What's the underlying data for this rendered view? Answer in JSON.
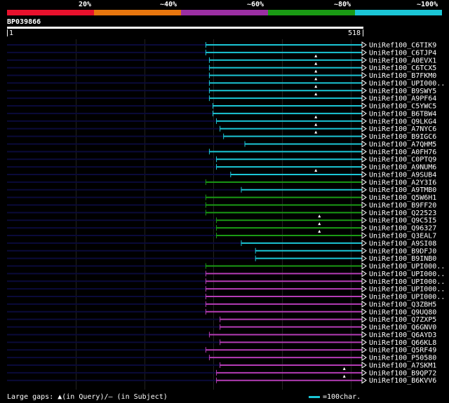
{
  "legend": {
    "labels": [
      "20%",
      "~40%",
      "~60%",
      "~80%",
      "~100%"
    ],
    "colors": [
      "#e8112d",
      "#e7760e",
      "#9b2fa3",
      "#1a9a14",
      "#1bc6d6"
    ]
  },
  "query": {
    "title": "BP039866",
    "start": "1",
    "end": "518"
  },
  "colors": {
    "cyan": "#1bc6d6",
    "green": "#1a9a14",
    "magenta": "#b53cb6",
    "faint": "#0a0a3a"
  },
  "hits": [
    {
      "label": "UniRef100_C6TIK9",
      "color": "cyan",
      "start": 0.56,
      "mark": null
    },
    {
      "label": "UniRef100_C6TJP4",
      "color": "cyan",
      "start": 0.56,
      "mark": null
    },
    {
      "label": "UniRef100_A0EVX1",
      "color": "cyan",
      "start": 0.57,
      "mark": 0.87
    },
    {
      "label": "UniRef100_C6TCX5",
      "color": "cyan",
      "start": 0.57,
      "mark": 0.87
    },
    {
      "label": "UniRef100_B7FKM0",
      "color": "cyan",
      "start": 0.57,
      "mark": 0.87
    },
    {
      "label": "UniRef100_UPI000..",
      "color": "cyan",
      "start": 0.57,
      "mark": 0.87
    },
    {
      "label": "UniRef100_B9SWY5",
      "color": "cyan",
      "start": 0.57,
      "mark": 0.87
    },
    {
      "label": "UniRef100_A9PF64",
      "color": "cyan",
      "start": 0.57,
      "mark": 0.87
    },
    {
      "label": "UniRef100_C5YWC5",
      "color": "cyan",
      "start": 0.58,
      "mark": null
    },
    {
      "label": "UniRef100_B6TBW4",
      "color": "cyan",
      "start": 0.58,
      "mark": null
    },
    {
      "label": "UniRef100_Q9LKG4",
      "color": "cyan",
      "start": 0.59,
      "mark": 0.87
    },
    {
      "label": "UniRef100_A7NYC6",
      "color": "cyan",
      "start": 0.6,
      "mark": 0.87
    },
    {
      "label": "UniRef100_B9IGC6",
      "color": "cyan",
      "start": 0.61,
      "mark": 0.87
    },
    {
      "label": "UniRef100_A7QHM5",
      "color": "cyan",
      "start": 0.67,
      "mark": null
    },
    {
      "label": "UniRef100_A0FH76",
      "color": "cyan",
      "start": 0.57,
      "mark": null
    },
    {
      "label": "UniRef100_C0PTQ9",
      "color": "cyan",
      "start": 0.59,
      "mark": null
    },
    {
      "label": "UniRef100_A9NUM6",
      "color": "cyan",
      "start": 0.59,
      "mark": null
    },
    {
      "label": "UniRef100_A9SUB4",
      "color": "cyan",
      "start": 0.63,
      "mark": 0.87
    },
    {
      "label": "UniRef100_A2Y3I6",
      "color": "green",
      "start": 0.56,
      "mark": null
    },
    {
      "label": "UniRef100_A9TMB0",
      "color": "cyan",
      "start": 0.66,
      "mark": null
    },
    {
      "label": "UniRef100_Q5W6H1",
      "color": "green",
      "start": 0.56,
      "mark": null
    },
    {
      "label": "UniRef100_B9FF20",
      "color": "green",
      "start": 0.56,
      "mark": null
    },
    {
      "label": "UniRef100_Q22523",
      "color": "green",
      "start": 0.56,
      "mark": null
    },
    {
      "label": "UniRef100_Q9C5I5",
      "color": "green",
      "start": 0.59,
      "mark": 0.88
    },
    {
      "label": "UniRef100_Q96327",
      "color": "green",
      "start": 0.59,
      "mark": 0.88
    },
    {
      "label": "UniRef100_Q3EAL7",
      "color": "green",
      "start": 0.59,
      "mark": 0.88
    },
    {
      "label": "UniRef100_A9SI08",
      "color": "cyan",
      "start": 0.66,
      "mark": null
    },
    {
      "label": "UniRef100_B9DFJ0",
      "color": "cyan",
      "start": 0.7,
      "mark": null
    },
    {
      "label": "UniRef100_B9INB0",
      "color": "cyan",
      "start": 0.7,
      "mark": null
    },
    {
      "label": "UniRef100_UPI000..",
      "color": "green",
      "start": 0.56,
      "mark": null
    },
    {
      "label": "UniRef100_UPI000..",
      "color": "magenta",
      "start": 0.56,
      "mark": null
    },
    {
      "label": "UniRef100_UPI000..",
      "color": "magenta",
      "start": 0.56,
      "mark": null
    },
    {
      "label": "UniRef100_UPI000..",
      "color": "magenta",
      "start": 0.56,
      "mark": null
    },
    {
      "label": "UniRef100_UPI000..",
      "color": "magenta",
      "start": 0.56,
      "mark": null
    },
    {
      "label": "UniRef100_Q3ZBH5",
      "color": "magenta",
      "start": 0.56,
      "mark": null
    },
    {
      "label": "UniRef100_Q9UQ80",
      "color": "magenta",
      "start": 0.56,
      "mark": null
    },
    {
      "label": "UniRef100_Q7ZXP5",
      "color": "magenta",
      "start": 0.6,
      "mark": null
    },
    {
      "label": "UniRef100_Q6GNV0",
      "color": "magenta",
      "start": 0.6,
      "mark": null
    },
    {
      "label": "UniRef100_Q6AYD3",
      "color": "magenta",
      "start": 0.57,
      "mark": null
    },
    {
      "label": "UniRef100_Q66KL8",
      "color": "magenta",
      "start": 0.6,
      "mark": null
    },
    {
      "label": "UniRef100_Q5RF49",
      "color": "magenta",
      "start": 0.56,
      "mark": null
    },
    {
      "label": "UniRef100_P50580",
      "color": "magenta",
      "start": 0.57,
      "mark": null
    },
    {
      "label": "UniRef100_A7SKM1",
      "color": "magenta",
      "start": 0.6,
      "mark": null
    },
    {
      "label": "UniRef100_B9QP72",
      "color": "magenta",
      "start": 0.59,
      "mark": 0.95
    },
    {
      "label": "UniRef100_B6KVV6",
      "color": "magenta",
      "start": 0.59,
      "mark": 0.95
    }
  ],
  "footer": {
    "large_gaps": "Large gaps: ▲(in Query)/– (in Subject)",
    "scale": "=100char."
  }
}
